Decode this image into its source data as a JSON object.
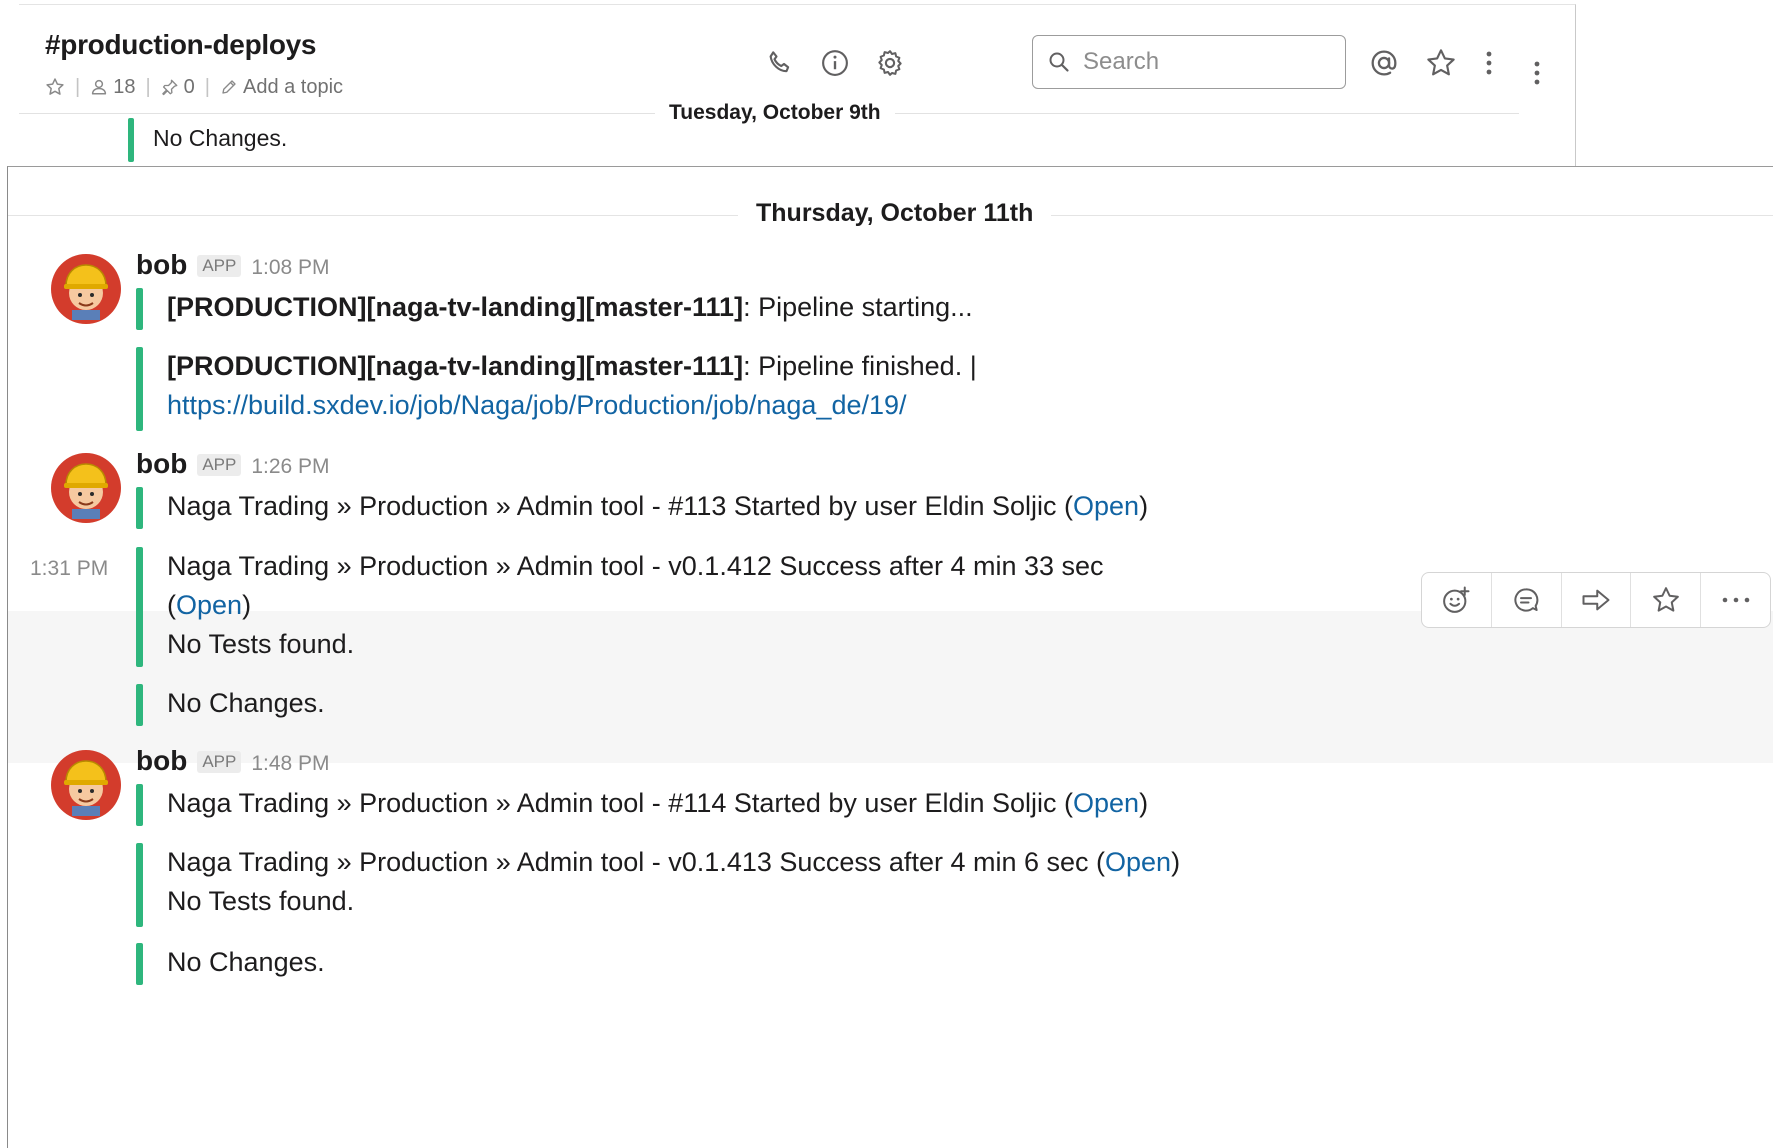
{
  "channel": {
    "name": "#production-deploys",
    "members": "18",
    "pins": "0",
    "topic_label": "Add a topic"
  },
  "search": {
    "placeholder": "Search"
  },
  "earlier": {
    "date": "Tuesday, October 9th",
    "message": "No Changes."
  },
  "day": {
    "label": "Thursday, October 11th"
  },
  "messages": [
    {
      "author": "bob",
      "badge": "APP",
      "time": "1:08 PM",
      "att1": {
        "bold": "[PRODUCTION][naga-tv-landing][master-111]",
        "text": ": Pipeline starting..."
      },
      "att2": {
        "bold": "[PRODUCTION][naga-tv-landing][master-111]",
        "text": ": Pipeline finished. |",
        "link": "https://build.sxdev.io/job/Naga/job/Production/job/naga_de/19/"
      }
    },
    {
      "author": "bob",
      "badge": "APP",
      "time": "1:26 PM",
      "att1": {
        "text": "Naga Trading » Production » Admin tool - #113 Started by user Eldin Soljic (",
        "link": "Open",
        "close": ")"
      },
      "hover_time": "1:31 PM",
      "att2": {
        "text": "Naga Trading » Production » Admin tool - v0.1.412 Success after 4 min 33 sec",
        "open_paren": "(",
        "link": "Open",
        "close": ")",
        "line3": "No Tests found."
      },
      "att3": {
        "text": "No Changes."
      }
    },
    {
      "author": "bob",
      "badge": "APP",
      "time": "1:48 PM",
      "att1": {
        "text": "Naga Trading » Production » Admin tool - #114 Started by user Eldin Soljic (",
        "link": "Open",
        "close": ")"
      },
      "att2": {
        "text": "Naga Trading » Production » Admin tool - v0.1.413 Success after 4 min 6 sec (",
        "link": "Open",
        "close": ")",
        "line2": "No Tests found."
      },
      "att3": {
        "text": "No Changes."
      }
    }
  ],
  "header_icons": [
    "phone-icon",
    "info-icon",
    "gear-icon",
    "mention-icon",
    "star-icon",
    "more-icon"
  ],
  "message_actions": [
    "add-reaction-icon",
    "start-thread-icon",
    "share-message-icon",
    "star-message-icon",
    "more-actions-icon"
  ],
  "colors": {
    "accent_green": "#2eb67d",
    "link_blue": "#1264a3",
    "text": "#1d1c1d",
    "muted": "#8a8a8a"
  }
}
